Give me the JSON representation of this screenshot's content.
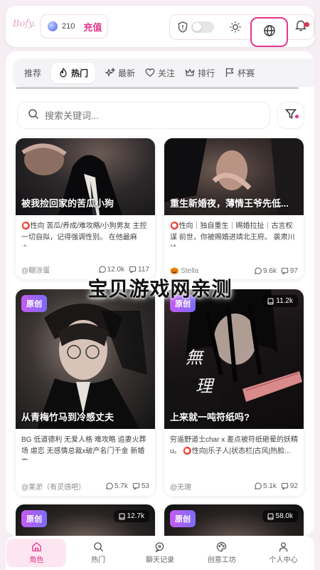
{
  "header": {
    "logo_text": "Bofy.",
    "coins": "210",
    "recharge_label": "充值",
    "icons": [
      "shield-icon",
      "toggle",
      "sun-icon",
      "globe-icon",
      "bell-icon"
    ]
  },
  "tabs": [
    {
      "label": "推荐",
      "icon": ""
    },
    {
      "label": "热门",
      "icon": "flame-icon",
      "active": true
    },
    {
      "label": "最新",
      "icon": "sparkle-icon"
    },
    {
      "label": "关注",
      "icon": "heart-icon"
    },
    {
      "label": "排行",
      "icon": "crown-icon"
    },
    {
      "label": "杯赛",
      "icon": "flag-icon"
    }
  ],
  "search": {
    "placeholder": "搜索关键词..."
  },
  "cards": [
    {
      "title": "被我捡回家的苦瓜小狗",
      "desc": "⭕性向 苦瓜/养成/难攻略/小狗男友 主控一切自拟，记得强调性别。 在他最麻木...",
      "author": "@糊涂蛋",
      "likes": "12.0k",
      "chats": "117"
    },
    {
      "title": "重生新婚夜，薄情王爷先低...",
      "desc": "⭕性向｜独自重生｜赐婚拉扯｜古言权谋 前世，你被赐婚进靖北王府。 裴肃川给...",
      "author": "🎃 Stella",
      "likes": "9.6k",
      "chats": "97"
    },
    {
      "badge": "原创",
      "title": "从青梅竹马到冷感丈夫",
      "desc": "BG 低道德利 无爱人格 难攻略 追妻火葬场 虐恋 无感情总裁x破产名门千金 新婚夜...",
      "author": "@莱淤（有灵感吧）",
      "likes": "5.7k",
      "chats": "53"
    },
    {
      "badge": "原创",
      "count": "11.2k",
      "title": "上来就一吨符纸吗?",
      "desc": "穷遥野道士char x 差点被符纸砸晕的妖精u。 ⭕性向|乐子人|状态栏|古风|热脸...",
      "author": "@无理",
      "likes": "5.1k",
      "chats": "92",
      "cover_text": [
        "無",
        "理"
      ]
    },
    {
      "badge": "原创",
      "count": "12.7k"
    },
    {
      "badge": "原创",
      "count": "58.0k"
    }
  ],
  "watermark": "宝贝游戏网亲测",
  "bottom_nav": [
    {
      "label": "角色",
      "icon": "home-icon",
      "active": true
    },
    {
      "label": "热门",
      "icon": "search-icon"
    },
    {
      "label": "聊天记录",
      "icon": "chat-icon"
    },
    {
      "label": "创意工坊",
      "icon": "palette-icon"
    },
    {
      "label": "个人中心",
      "icon": "user-icon"
    }
  ],
  "colors": {
    "accent": "#e4368e",
    "badge_start": "#c45bf2",
    "badge_end": "#7b6cf6",
    "notification": "#e5334d"
  }
}
